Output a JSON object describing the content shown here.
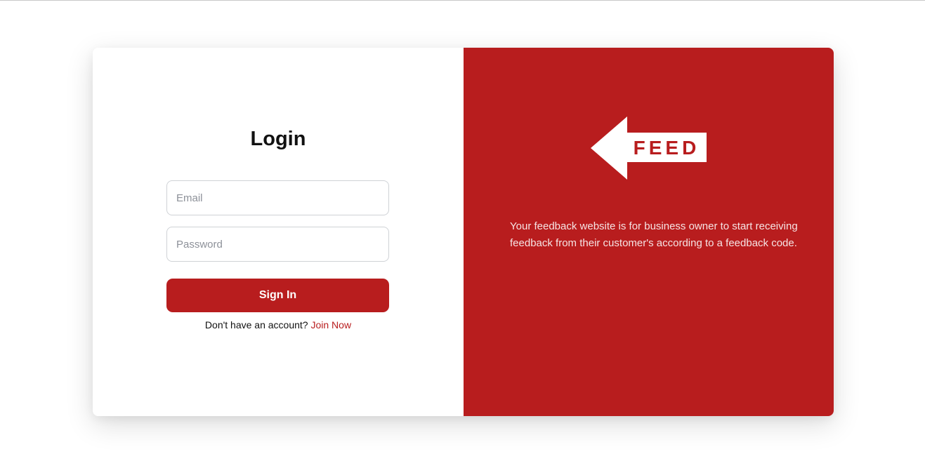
{
  "login": {
    "title": "Login",
    "email_placeholder": "Email",
    "password_placeholder": "Password",
    "sign_in_label": "Sign In",
    "signup_prompt": "Don't have an account?",
    "join_link": "Join Now"
  },
  "brand": {
    "logo_text": "FEED",
    "logo_icon": "arrow-left-icon",
    "tagline": "Your feedback website is for business owner to start receiving feedback from their customer's according to a feedback code."
  },
  "colors": {
    "accent": "#b81d1e",
    "background": "#ffffff",
    "input_border": "#cfd2d6"
  }
}
